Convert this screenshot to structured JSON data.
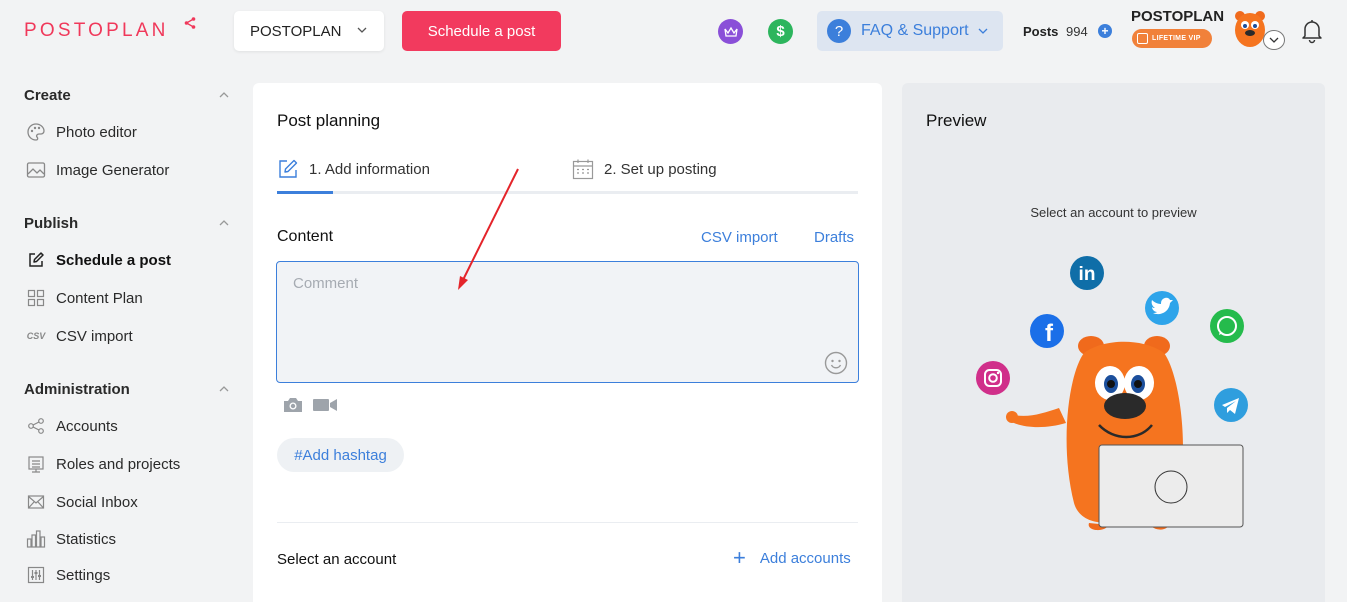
{
  "header": {
    "logo": "POSTOPLAN",
    "project": "POSTOPLAN",
    "schedule_button": "Schedule a post",
    "faq_label": "FAQ & Support",
    "faq_glyph": "?",
    "posts_label": "Posts",
    "posts_count": "994",
    "brand": "POSTOPLAN",
    "vip_badge": "LIFETIME VIP",
    "dollar_glyph": "$"
  },
  "sidebar": {
    "sections": [
      {
        "title": "Create",
        "items": [
          {
            "label": "Photo editor",
            "icon": "palette-icon"
          },
          {
            "label": "Image Generator",
            "icon": "image-icon"
          }
        ]
      },
      {
        "title": "Publish",
        "items": [
          {
            "label": "Schedule a post",
            "icon": "edit-icon",
            "active": true
          },
          {
            "label": "Content Plan",
            "icon": "grid-icon"
          },
          {
            "label": "CSV import",
            "icon": "csv-icon"
          }
        ]
      },
      {
        "title": "Administration",
        "items": [
          {
            "label": "Accounts",
            "icon": "share-icon"
          },
          {
            "label": "Roles and projects",
            "icon": "board-icon"
          },
          {
            "label": "Social Inbox",
            "icon": "mail-icon"
          },
          {
            "label": "Statistics",
            "icon": "chart-icon"
          },
          {
            "label": "Settings",
            "icon": "sliders-icon"
          }
        ]
      }
    ],
    "csv_glyph": "CSV"
  },
  "main": {
    "title": "Post planning",
    "steps": [
      "1. Add information",
      "2. Set up posting"
    ],
    "content_title": "Content",
    "csv_import": "CSV import",
    "drafts": "Drafts",
    "comment_placeholder": "Comment",
    "hashtag": "#Add hashtag",
    "select_account": "Select an account",
    "add_accounts": "Add accounts"
  },
  "preview": {
    "title": "Preview",
    "hint": "Select an account to preview",
    "linkedin_glyph": "in",
    "facebook_glyph": "f"
  },
  "colors": {
    "accent": "#f23a5e",
    "link": "#3c7fdb"
  }
}
